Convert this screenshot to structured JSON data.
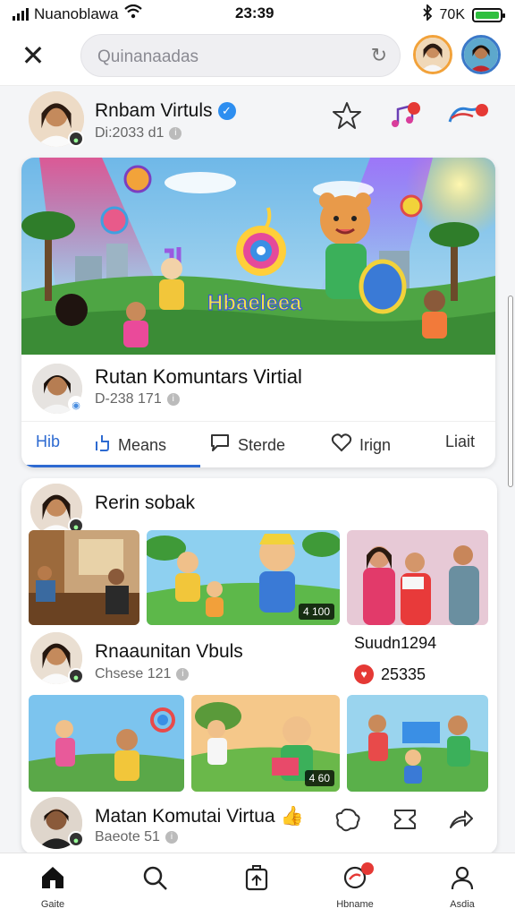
{
  "status_bar": {
    "carrier": "Nuanoblawa",
    "time": "23:39",
    "battery_text": "70K",
    "battery_level": 0.85
  },
  "top_bar": {
    "search_placeholder": "Quinanaadas"
  },
  "profile": {
    "name": "Rnbam Virtuls",
    "meta": "Di:2033 d1"
  },
  "featured": {
    "banner_text": "Hbaeleea",
    "name": "Rutan Komuntars Virtial",
    "meta": "D-238 171"
  },
  "tabs": [
    {
      "label": "Hib",
      "icon": ""
    },
    {
      "label": "Means",
      "icon": "like-icon"
    },
    {
      "label": "Sterde",
      "icon": "comment-icon"
    },
    {
      "label": "Irign",
      "icon": "heart-icon"
    },
    {
      "label": "Liait",
      "icon": ""
    }
  ],
  "section1": {
    "name": "Rerin sobak"
  },
  "grid1": [
    {
      "duration": ""
    },
    {
      "duration": "4 100"
    },
    {
      "duration": ""
    }
  ],
  "section2": {
    "name": "Rnaaunitan Vbuls",
    "meta": "Chsese 121",
    "right_label": "Suudn1294",
    "right_count": "25335"
  },
  "grid2": [
    {
      "duration": ""
    },
    {
      "duration": "4 60"
    },
    {
      "duration": ""
    }
  ],
  "section3": {
    "name": "Matan Komutai Virtua",
    "meta": "Baeote 51"
  },
  "bottom_nav": [
    {
      "label": "Gaite",
      "icon": "home-icon"
    },
    {
      "label": "",
      "icon": "search-icon"
    },
    {
      "label": "",
      "icon": "upload-icon"
    },
    {
      "label": "Hbname",
      "icon": "notifications-icon"
    },
    {
      "label": "Asdia",
      "icon": "profile-icon"
    }
  ],
  "colors": {
    "accent": "#2d6ad1",
    "verified": "#2d8ef0",
    "notification": "#e53935"
  }
}
